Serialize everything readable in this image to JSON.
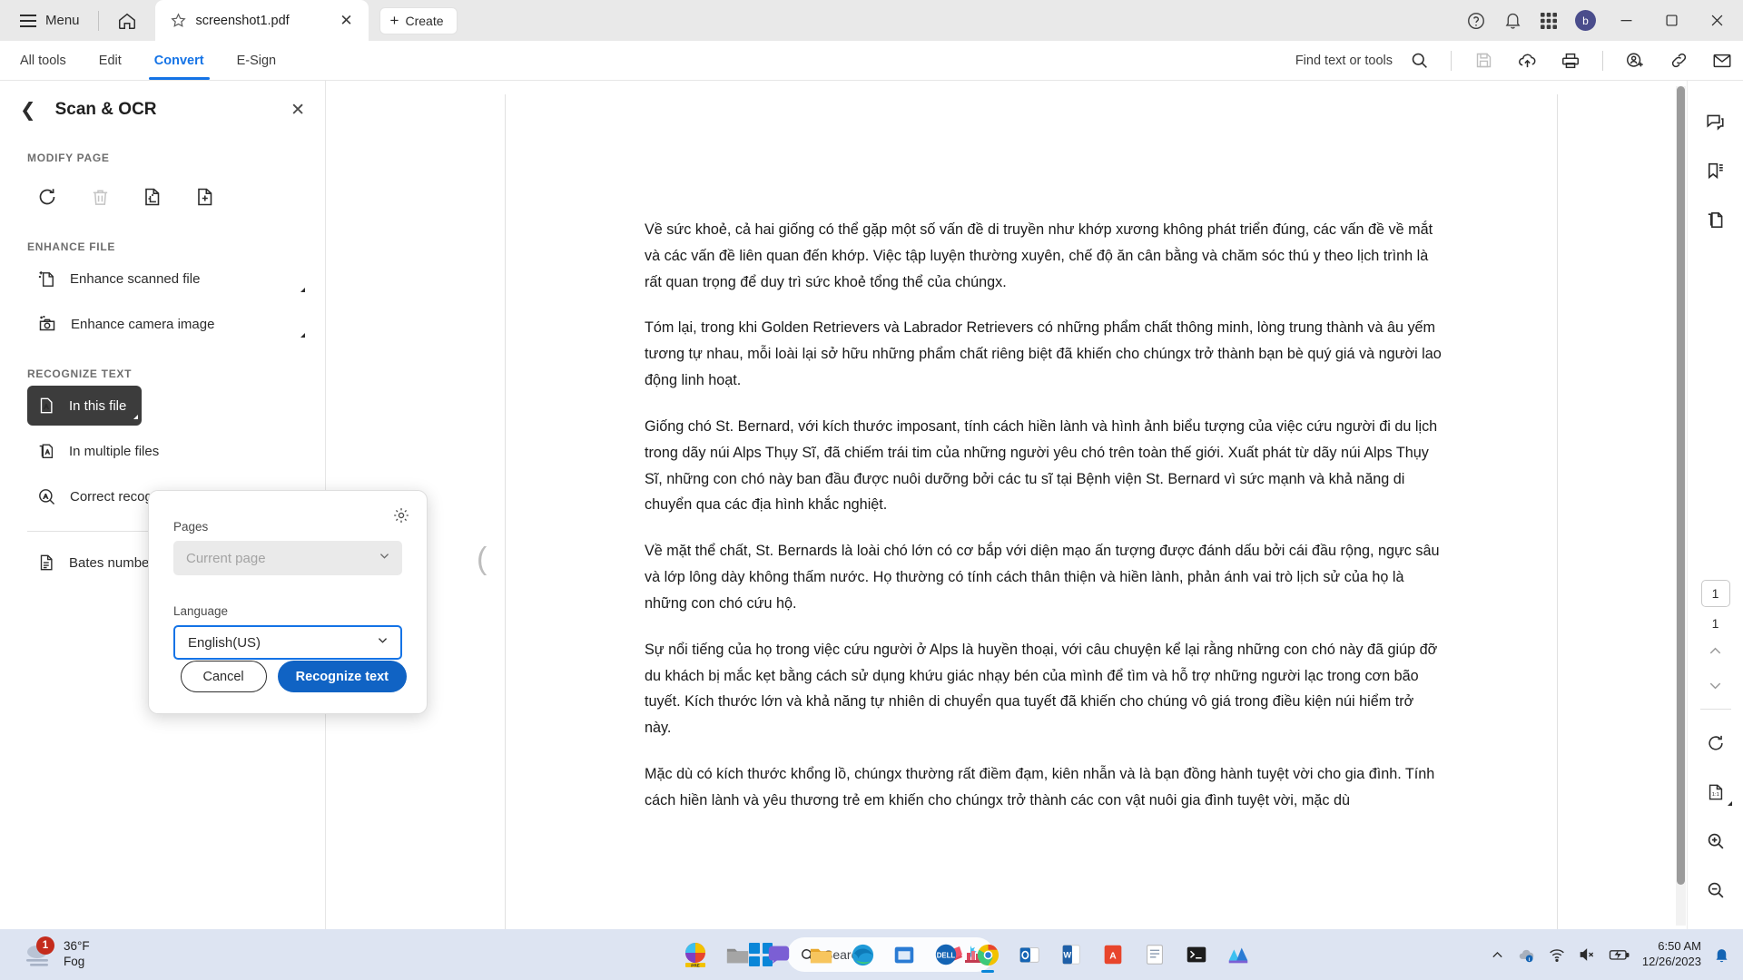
{
  "titlebar": {
    "menu_label": "Menu",
    "tab_title": "screenshot1.pdf",
    "create_label": "Create",
    "close_glyph": "✕"
  },
  "menubar": {
    "items": [
      {
        "label": "All tools",
        "active": false
      },
      {
        "label": "Edit",
        "active": false
      },
      {
        "label": "Convert",
        "active": true
      },
      {
        "label": "E-Sign",
        "active": false
      }
    ],
    "find_label": "Find text or tools"
  },
  "left_panel": {
    "title": "Scan & OCR",
    "back_glyph": "❮",
    "close_glyph": "✕",
    "sections": {
      "modify_page": "MODIFY PAGE",
      "enhance_file": "ENHANCE FILE",
      "recognize_text": "RECOGNIZE TEXT"
    },
    "enhance_items": [
      {
        "label": "Enhance scanned file"
      },
      {
        "label": "Enhance camera image"
      }
    ],
    "recognize_items": [
      {
        "label": "In this file",
        "selected": true
      },
      {
        "label": "In multiple files",
        "selected": false
      },
      {
        "label": "Correct recognized text",
        "selected": false
      }
    ],
    "bates": {
      "label": "Bates numbering"
    }
  },
  "dialog": {
    "pages_label": "Pages",
    "pages_value": "Current page",
    "language_label": "Language",
    "language_value": "English(US)",
    "cancel_label": "Cancel",
    "confirm_label": "Recognize text",
    "accent_color": "#1063c4"
  },
  "document": {
    "paragraphs": [
      "Về sức khoẻ, cả hai giống có thể gặp một số vấn đề di truyền như khớp xương không phát triển đúng, các vấn đề về mắt và các vấn đề liên quan đến khớp. Việc tập luyện thường xuyên, chế độ ăn cân bằng và chăm sóc thú y theo lịch trình là rất quan trọng để duy trì sức khoẻ tổng thể của chúngx.",
      "Tóm lại, trong khi Golden Retrievers và Labrador Retrievers có những phẩm chất thông minh, lòng trung thành và âu yếm tương tự nhau, mỗi loài lại sở hữu những phẩm chất riêng biệt đã khiến cho chúngx trở thành bạn bè quý giá và người lao động linh hoạt.",
      "Giống chó St. Bernard, với kích thước imposant, tính cách hiền lành và hình ảnh biểu tượng của việc cứu người đi du lịch trong dãy núi Alps Thụy Sĩ, đã chiếm trái tim của những người yêu chó trên toàn thế giới. Xuất phát từ dãy núi Alps Thụy Sĩ, những con chó này ban đầu được nuôi dưỡng bởi các tu sĩ tại Bệnh viện St. Bernard vì sức mạnh và khả năng di chuyển qua các địa hình khắc nghiệt.",
      "Về mặt thể chất, St. Bernards là loài chó lớn có cơ bắp với diện mạo ấn tượng được đánh dấu bởi cái đầu rộng, ngực sâu và lớp lông dày không thấm nước. Họ thường có tính cách thân thiện và hiền lành, phản ánh vai trò lịch sử của họ là những con chó cứu hộ.",
      "Sự nổi tiếng của họ trong việc cứu người ở Alps là huyền thoại, với câu chuyện kể lại rằng những con chó này đã giúp đỡ du khách bị mắc kẹt bằng cách sử dụng khứu giác nhạy bén của mình để tìm và hỗ trợ những người lạc trong cơn bão tuyết. Kích thước lớn và khả năng tự nhiên di chuyển qua tuyết đã khiến cho chúng vô giá trong điều kiện núi hiểm trở này.",
      "Mặc dù có kích thước khổng lồ, chúngx thường rất điềm đạm, kiên nhẫn và là bạn đồng hành tuyệt vời cho gia đình. Tính cách hiền lành và yêu thương trẻ em khiến cho chúngx trở thành các con vật nuôi gia đình tuyệt vời, mặc dù"
    ]
  },
  "right_rail": {
    "page_current": "1",
    "page_total": "1"
  },
  "taskbar": {
    "weather_temp": "36°F",
    "weather_cond": "Fog",
    "weather_badge": "1",
    "search_placeholder": "Search",
    "clock_time": "6:50 AM",
    "clock_date": "12/26/2023"
  }
}
